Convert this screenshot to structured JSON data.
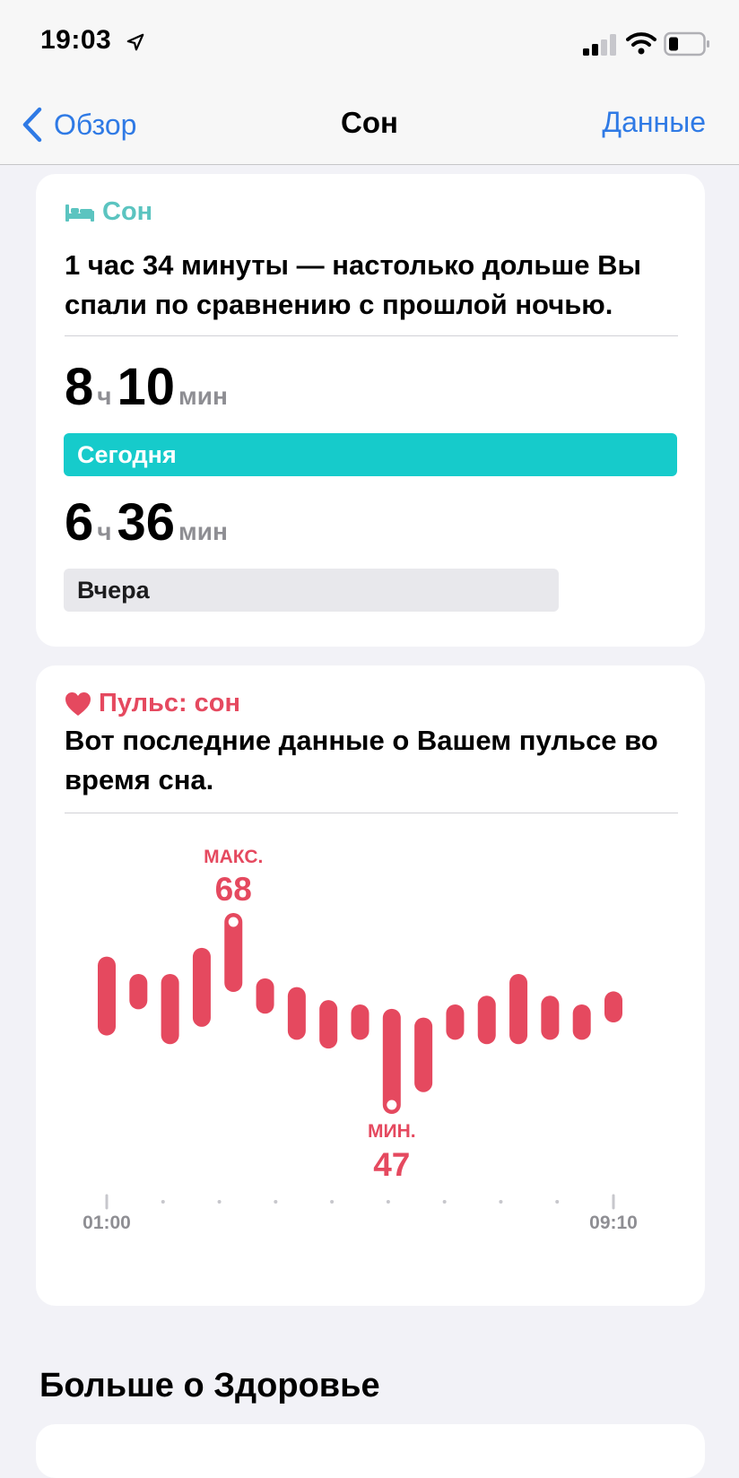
{
  "status_bar": {
    "time": "19:03"
  },
  "nav": {
    "back_label": "Обзор",
    "title": "Сон",
    "action_label": "Данные"
  },
  "sleep_card": {
    "header": "Сон",
    "summary": "1 час 34 минуты — настолько дольше Вы спали по сравнению с прошлой ночью.",
    "today": {
      "hours": "8",
      "hours_unit": "ч",
      "minutes": "10",
      "minutes_unit": "мин",
      "label": "Сегодня",
      "total_minutes": 490
    },
    "yesterday": {
      "hours": "6",
      "hours_unit": "ч",
      "minutes": "36",
      "minutes_unit": "мин",
      "label": "Вчера",
      "total_minutes": 396
    }
  },
  "heart_card": {
    "header": "Пульс: сон",
    "summary": "Вот последние данные о Вашем пульсе во время сна."
  },
  "chart_data": {
    "type": "bar",
    "title": "",
    "series": [
      {
        "ranges": [
          [
            56,
            63
          ],
          [
            59,
            61
          ],
          [
            55,
            61
          ],
          [
            57,
            64
          ],
          [
            61,
            68
          ],
          [
            58.5,
            60.5
          ],
          [
            55.5,
            59.5
          ],
          [
            54.5,
            58
          ],
          [
            55.5,
            57.5
          ],
          [
            47,
            57
          ],
          [
            49.5,
            56
          ],
          [
            55.5,
            57.5
          ],
          [
            55,
            58.5
          ],
          [
            55,
            61
          ],
          [
            55.5,
            58.5
          ],
          [
            55.5,
            57.5
          ],
          [
            57.5,
            59
          ]
        ]
      }
    ],
    "max": {
      "label": "МАКС.",
      "value": "68",
      "index": 4
    },
    "min": {
      "label": "МИН.",
      "value": "47",
      "index": 9
    },
    "x_start_label": "01:00",
    "x_end_label": "09:10",
    "colors": {
      "bar": "#e5495f",
      "axis": "#c7c7cc",
      "label": "#8e8e93"
    }
  },
  "more_section": {
    "title": "Больше о Здоровье"
  },
  "colors": {
    "accent_blue": "#2f7ae5",
    "sleep_teal": "#16cbcb",
    "heart_red": "#e5495f"
  }
}
